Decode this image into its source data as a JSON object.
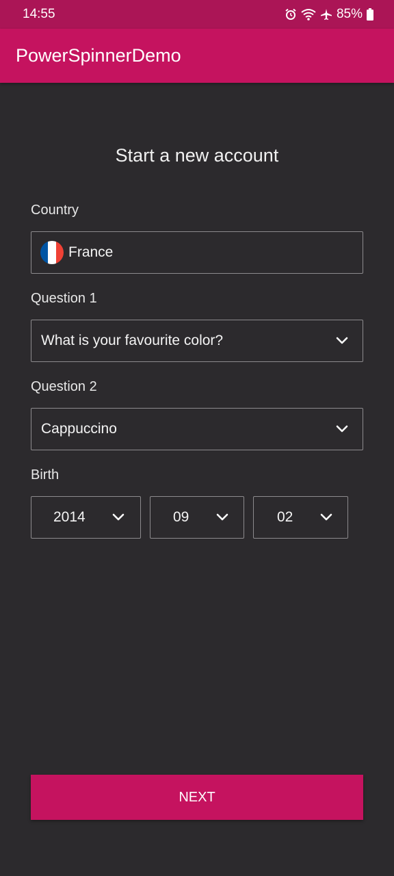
{
  "status_bar": {
    "time": "14:55",
    "battery": "85%",
    "icons": [
      "alarm-icon",
      "wifi-icon",
      "airplane-icon",
      "battery-icon"
    ]
  },
  "app_bar": {
    "title": "PowerSpinnerDemo"
  },
  "form": {
    "heading": "Start a new account",
    "country": {
      "label": "Country",
      "value": "France",
      "flag_colors": [
        "#0055a4",
        "#ffffff",
        "#ef4135"
      ]
    },
    "question1": {
      "label": "Question 1",
      "value": "What is your favourite color?"
    },
    "question2": {
      "label": "Question 2",
      "value": "Cappuccino"
    },
    "birth": {
      "label": "Birth",
      "year": "2014",
      "month": "09",
      "day": "02"
    },
    "next_label": "NEXT"
  },
  "colors": {
    "accent": "#c5135f",
    "status_bar": "#ab1556",
    "background": "#2c2a2d",
    "border": "#8d8b8e"
  }
}
